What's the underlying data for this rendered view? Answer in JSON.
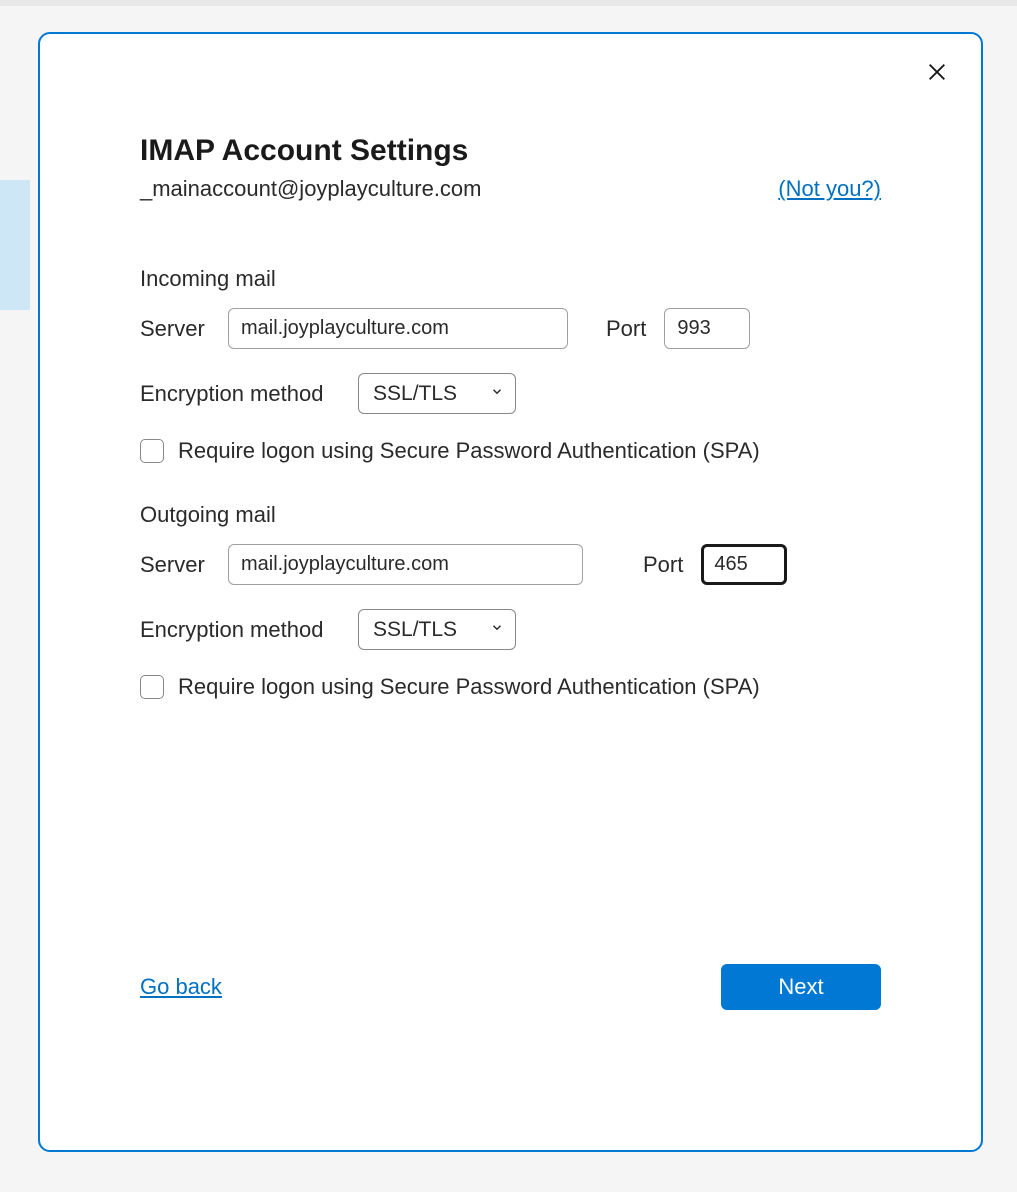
{
  "dialog": {
    "title": "IMAP Account Settings",
    "email": "_mainaccount@joyplayculture.com",
    "not_you_label": "(Not you?)",
    "incoming": {
      "header": "Incoming mail",
      "server_label": "Server",
      "server_value": "mail.joyplayculture.com",
      "port_label": "Port",
      "port_value": "993",
      "encryption_label": "Encryption method",
      "encryption_value": "SSL/TLS",
      "spa_label": "Require logon using Secure Password Authentication (SPA)"
    },
    "outgoing": {
      "header": "Outgoing mail",
      "server_label": "Server",
      "server_value": "mail.joyplayculture.com",
      "port_label": "Port",
      "port_value": "465",
      "encryption_label": "Encryption method",
      "encryption_value": "SSL/TLS",
      "spa_label": "Require logon using Secure Password Authentication (SPA)"
    },
    "go_back_label": "Go back",
    "next_label": "Next"
  }
}
